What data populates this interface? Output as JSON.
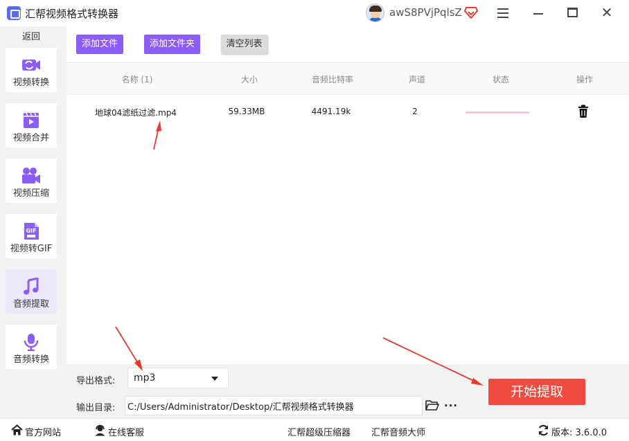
{
  "app": {
    "title": "汇帮视频格式转换器",
    "username": "awS8PVjPqlsZ"
  },
  "sidebar": {
    "back_label": "返回",
    "items": [
      {
        "label": "视频转换",
        "icon": "video-convert-icon",
        "active": false
      },
      {
        "label": "视频合并",
        "icon": "video-merge-icon",
        "active": false
      },
      {
        "label": "视频压缩",
        "icon": "video-compress-icon",
        "active": false
      },
      {
        "label": "视频转GIF",
        "icon": "gif-icon",
        "active": false
      },
      {
        "label": "音频提取",
        "icon": "music-note-icon",
        "active": true
      },
      {
        "label": "音频转换",
        "icon": "microphone-icon",
        "active": false
      }
    ],
    "gif_badge": "GIF"
  },
  "toolbar": {
    "add_file": "添加文件",
    "add_folder": "添加文件夹",
    "clear_list": "清空列表"
  },
  "table": {
    "columns": [
      "名称 (1)",
      "大小",
      "音频比特率",
      "声道",
      "状态",
      "操作"
    ],
    "rows": [
      {
        "name": "地球04滤纸过滤.mp4",
        "size": "59.33MB",
        "bitrate": "4491.19k",
        "channels": "2"
      }
    ]
  },
  "bottom": {
    "format_label": "导出格式:",
    "format_value": "mp3",
    "output_label": "输出目录:",
    "output_path": "C:/Users/Administrator/Desktop/汇帮视频格式转换器",
    "more": "···",
    "start_button": "开始提取"
  },
  "footer": {
    "official_site": "官方网站",
    "online_service": "在线客服",
    "compressor": "汇帮超级压缩器",
    "audio_master": "汇帮音频大师",
    "version": "版本:  3.6.0.0"
  },
  "colors": {
    "accent": "#8b5cf6",
    "start": "#f14a3e",
    "annotation": "#e8392f"
  }
}
